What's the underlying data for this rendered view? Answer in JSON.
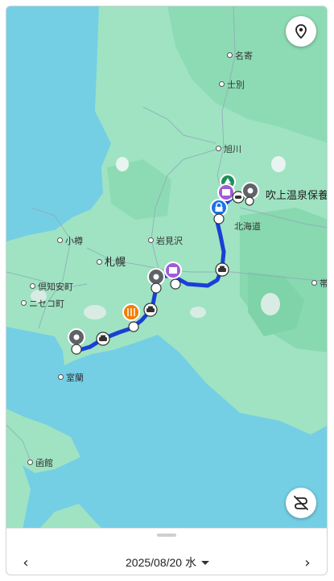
{
  "map": {
    "labels": {
      "nayoro": "名寄",
      "shibetsu": "士別",
      "asahikawa": "旭川",
      "fukiage": "吹上温泉保養",
      "hokkaido": "北海道",
      "otaru": "小樽",
      "iwamizawa": "岩見沢",
      "sapporo": "札幌",
      "kutchan": "倶知安町",
      "niseko": "ニセコ町",
      "obihiro": "帯",
      "muroran": "室蘭",
      "hakodate": "函館"
    },
    "icons": {
      "location_button": "location-pin-icon",
      "layers_button": "route-off-icon"
    },
    "colors": {
      "route": "#1a3fd6",
      "land": "#9fe3c2",
      "water": "#74cfe5",
      "stop": "#5f6368",
      "food": "#f57c00",
      "hotel": "#a05bd6",
      "start": "#1e8e5a",
      "charge": "#1a73e8"
    }
  },
  "bottom_bar": {
    "date_label": "2025/08/20 水",
    "prev_label": "‹",
    "next_label": "›"
  }
}
